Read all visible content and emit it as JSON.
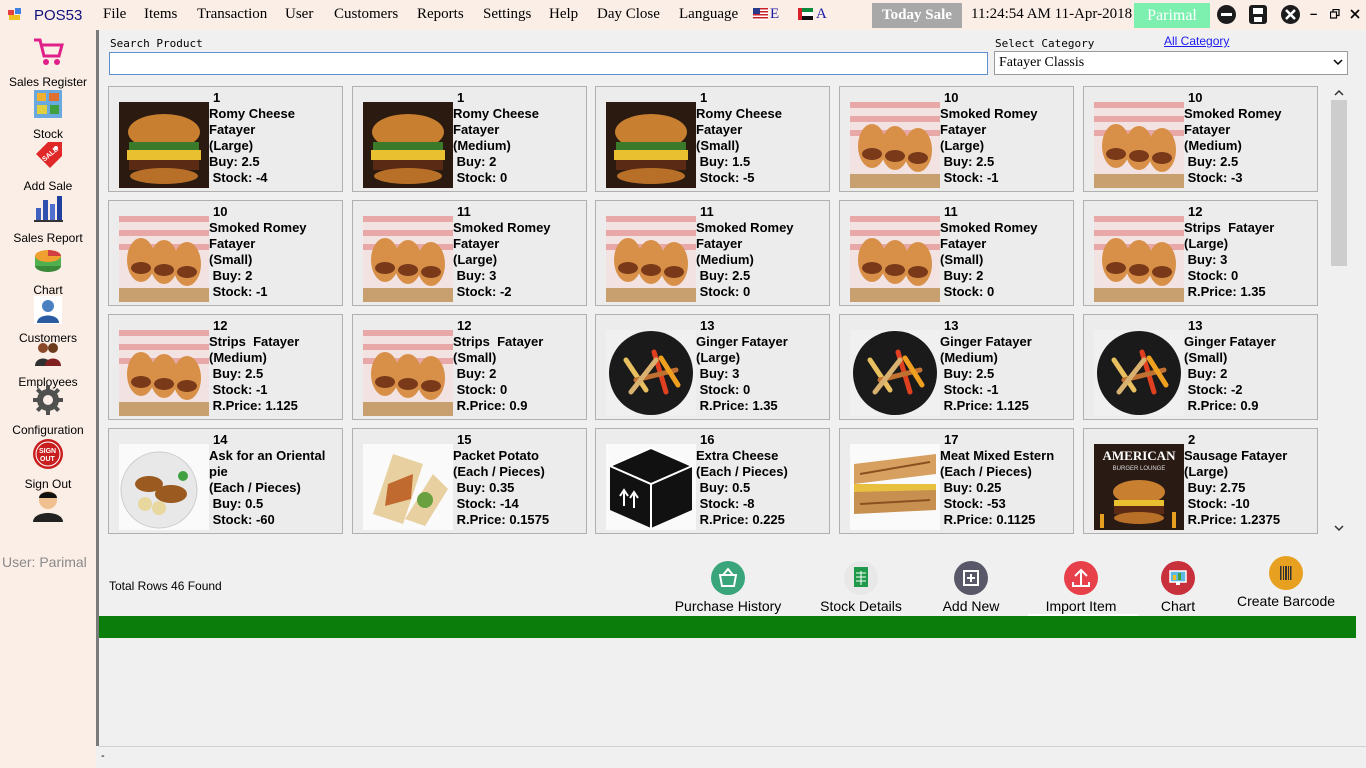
{
  "app": {
    "title": "POS53"
  },
  "menu": [
    {
      "label": "File"
    },
    {
      "label": "Items"
    },
    {
      "label": "Transaction"
    },
    {
      "label": "User"
    },
    {
      "label": "Customers"
    },
    {
      "label": "Reports"
    },
    {
      "label": "Settings"
    },
    {
      "label": "Help"
    },
    {
      "label": "Day Close"
    },
    {
      "label": "Language"
    }
  ],
  "languages": [
    {
      "label": "E",
      "icon": "us-flag-icon"
    },
    {
      "label": "A",
      "icon": "uae-flag-icon"
    }
  ],
  "status": {
    "today_sale": "Today Sale",
    "clock": "11:24:54 AM 11-Apr-2018",
    "user": "Parimal"
  },
  "sidebar": {
    "items": [
      {
        "label": "Sales Register",
        "icon": "shopping-cart-icon"
      },
      {
        "label": "Stock",
        "icon": "shelves-icon"
      },
      {
        "label": "Add Sale",
        "icon": "sale-tag-icon"
      },
      {
        "label": "Sales Report",
        "icon": "bar-chart-icon"
      },
      {
        "label": "Chart",
        "icon": "pie-chart-icon"
      },
      {
        "label": "Customers",
        "icon": "customer-icon"
      },
      {
        "label": "Employees",
        "icon": "employees-icon"
      },
      {
        "label": "Configuration",
        "icon": "gear-icon"
      },
      {
        "label": "Sign Out",
        "icon": "sign-out-icon"
      }
    ],
    "user_label": "User: Parimal"
  },
  "search": {
    "label": "Search Product",
    "value": ""
  },
  "category": {
    "label": "Select Category",
    "all_link": "All Category",
    "selected": "Fatayer Classis"
  },
  "products": [
    {
      "code": "1",
      "text": "Romy Cheese\nFatayer\n(Large)\nBuy: 2.5\n Stock: -4",
      "image": "burger"
    },
    {
      "code": "1",
      "text": "Romy Cheese\nFatayer\n(Medium)\n Buy: 2\n Stock: 0",
      "image": "burger"
    },
    {
      "code": "1",
      "text": "Romy Cheese\nFatayer\n(Small)\n Buy: 1.5\n Stock: -5",
      "image": "burger"
    },
    {
      "code": "10",
      "text": "Smoked Romey\nFatayer\n(Large)\n Buy: 2.5\n Stock: -1",
      "image": "sandwiches"
    },
    {
      "code": "10",
      "text": "Smoked Romey\nFatayer\n(Medium)\n Buy: 2.5\n Stock: -3",
      "image": "sandwiches"
    },
    {
      "code": "10",
      "text": "Smoked Romey\nFatayer\n(Small)\n Buy: 2\n Stock: -1",
      "image": "sandwiches"
    },
    {
      "code": "11",
      "text": "Smoked Romey\nFatayer\n(Large)\n Buy: 3\n Stock: -2",
      "image": "sandwiches"
    },
    {
      "code": "11",
      "text": "Smoked Romey\nFatayer\n(Medium)\n Buy: 2.5\n Stock: 0",
      "image": "sandwiches"
    },
    {
      "code": "11",
      "text": "Smoked Romey\nFatayer\n(Small)\n Buy: 2\n Stock: 0",
      "image": "sandwiches"
    },
    {
      "code": "12",
      "text": "Strips  Fatayer\n(Large)\n Buy: 3\n Stock: 0\n R.Price: 1.35",
      "image": "sandwiches"
    },
    {
      "code": "12",
      "text": "Strips  Fatayer\n(Medium)\n Buy: 2.5\n Stock: -1\n R.Price: 1.125",
      "image": "sandwiches"
    },
    {
      "code": "12",
      "text": "Strips  Fatayer\n(Small)\n Buy: 2\n Stock: 0\n R.Price: 0.9",
      "image": "sandwiches"
    },
    {
      "code": "13",
      "text": "Ginger Fatayer\n(Large)\n Buy: 3\n Stock: 0\n R.Price: 1.35",
      "image": "fajita"
    },
    {
      "code": "13",
      "text": "Ginger Fatayer\n(Medium)\n Buy: 2.5\n Stock: -1\n R.Price: 1.125",
      "image": "fajita"
    },
    {
      "code": "13",
      "text": "Ginger Fatayer\n(Small)\n Buy: 2\n Stock: -2\n R.Price: 0.9",
      "image": "fajita"
    },
    {
      "code": "14",
      "text": "Ask for an Oriental\npie\n(Each / Pieces)\n Buy: 0.5\n Stock: -60",
      "image": "plate"
    },
    {
      "code": "15",
      "text": "Packet Potato\n(Each / Pieces)\n Buy: 0.35\n Stock: -14\n R.Price: 0.1575",
      "image": "wrap"
    },
    {
      "code": "16",
      "text": "Extra Cheese\n(Each / Pieces)\n Buy: 0.5\n Stock: -8\n R.Price: 0.225",
      "image": "box"
    },
    {
      "code": "17",
      "text": "Meat Mixed Estern\n(Each / Pieces)\n Buy: 0.25\n Stock: -53\n R.Price: 0.1125",
      "image": "panini"
    },
    {
      "code": "2",
      "text": "Sausage Fatayer\n(Large)\n Buy: 2.75\n Stock: -10\n R.Price: 1.2375",
      "image": "american"
    }
  ],
  "american_logo": {
    "line1": "AMERICAN",
    "line2": "BURGER LOUNGE"
  },
  "footer": {
    "total_rows": "Total Rows 46 Found"
  },
  "actions": [
    {
      "label": "Purchase History",
      "icon": "basket-icon",
      "color": "#3aa57a"
    },
    {
      "label": "Stock Details",
      "icon": "spreadsheet-icon",
      "color": "#e8e8e8"
    },
    {
      "label": "Add New",
      "icon": "plus-box-icon",
      "color": "#585868"
    },
    {
      "label": "Import Item",
      "icon": "upload-icon",
      "color": "#e8404a"
    },
    {
      "label": "Chart",
      "icon": "monitor-chart-icon",
      "color": "#c8303c"
    },
    {
      "label": "Create Barcode",
      "icon": "barcode-icon",
      "color": "#e8a020"
    }
  ],
  "colors": {
    "green_bar": "#0a7d0a",
    "menu_bg": "#fbeee6",
    "today_sale_bg": "#a8a8a8",
    "user_badge_bg": "#7df0b0"
  }
}
